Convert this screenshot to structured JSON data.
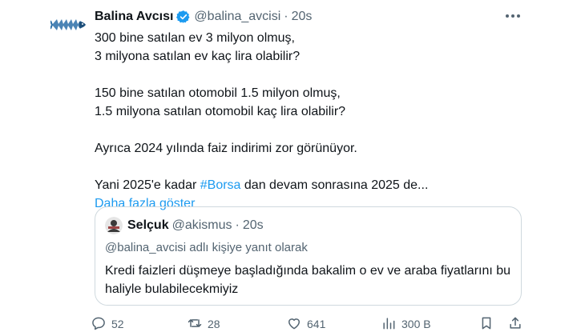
{
  "tweet": {
    "author": {
      "display_name": "Balina Avcısı",
      "verified_icon": "verified-badge-icon",
      "handle": "@balina_avcisi",
      "separator": "·",
      "time": "20s",
      "avatar_icon": "whale-logo-icon"
    },
    "more_icon": "more-dots-icon",
    "paragraphs": {
      "p1": "300 bine satılan ev 3 milyon olmuş,\n3 milyona satılan ev kaç lira olabilir?",
      "p2": "150 bine satılan otomobil 1.5 milyon olmuş,\n1.5 milyona satılan otomobil kaç lira olabilir?",
      "p3": "Ayrıca 2024 yılında faiz indirimi zor görünüyor.",
      "p4_before": "Yani 2025'e kadar ",
      "p4_hashtag": "#Borsa",
      "p4_after": " dan devam sonrasına 2025 de..."
    },
    "show_more": "Daha fazla göster",
    "quote": {
      "display_name": "Selçuk",
      "handle": "@akismus",
      "separator": "·",
      "time": "20s",
      "reply_context": "@balina_avcisi adlı kişiye yanıt olarak",
      "text": "Kredi faizleri  düşmeye başladığında bakalim o ev ve araba fiyatlarını bu haliyle bulabilecekmiyiz"
    },
    "actions": {
      "reply_count": "52",
      "retweet_count": "28",
      "like_count": "641",
      "views_count": "300 B",
      "icons": [
        "reply-icon",
        "retweet-icon",
        "like-icon",
        "views-icon",
        "bookmark-icon",
        "share-icon"
      ]
    }
  },
  "colors": {
    "accent": "#1d9bf0",
    "text": "#0f1419",
    "secondary": "#536471",
    "border": "#cfd9de"
  }
}
